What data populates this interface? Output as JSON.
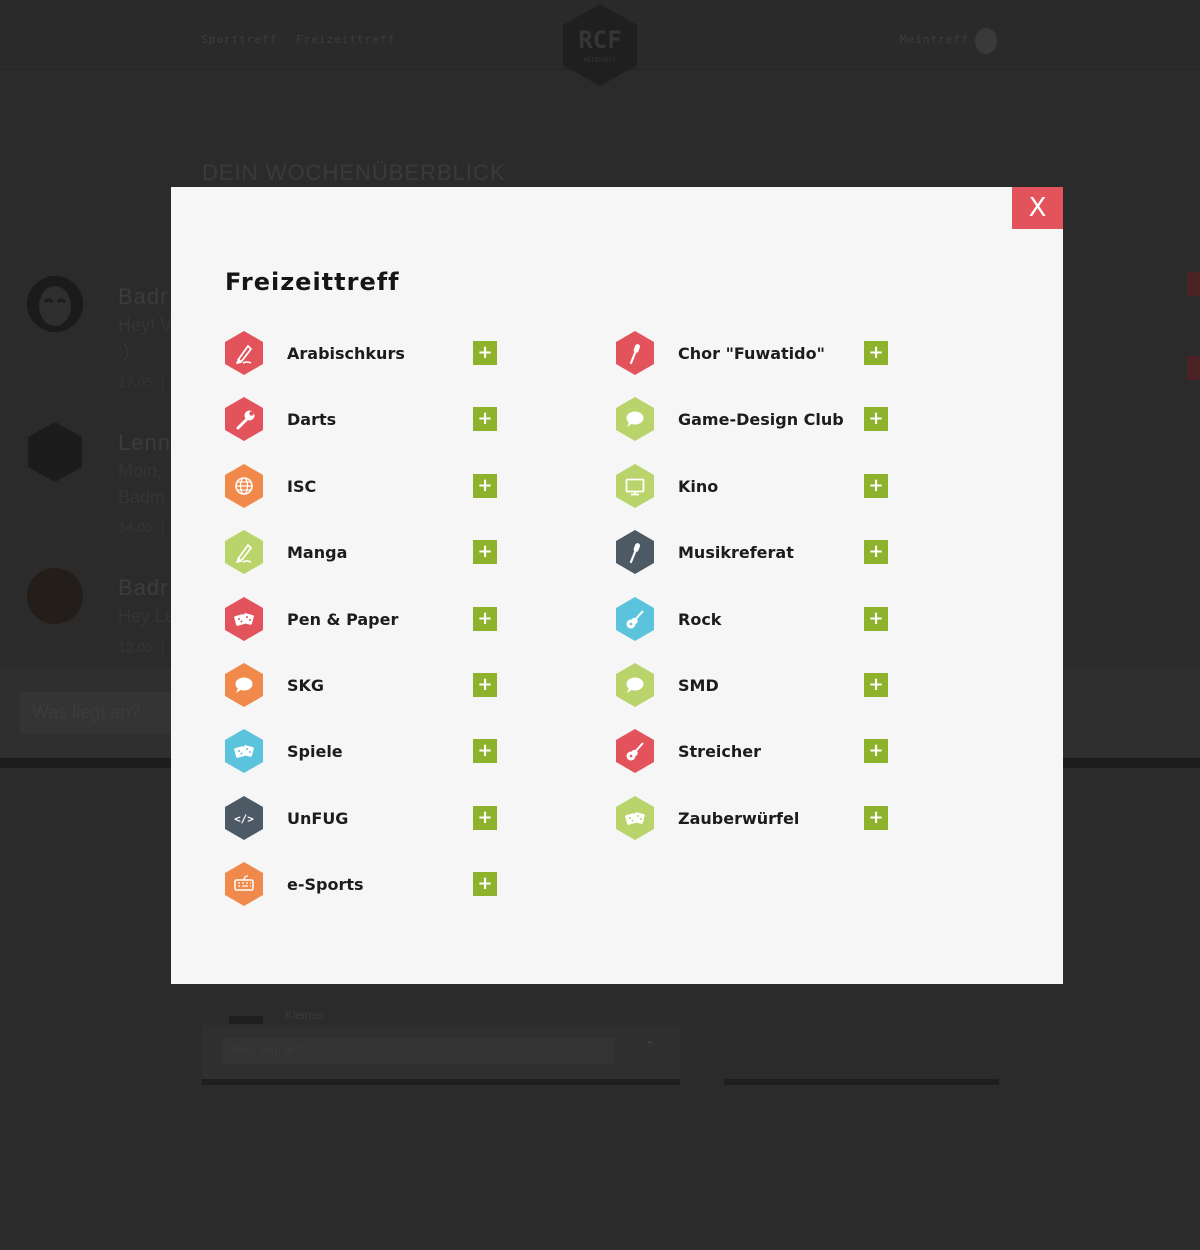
{
  "nav": {
    "left_links": [
      "Sporttreff",
      "Freizeittreff"
    ],
    "right_link": "Meintreff",
    "logo_text": "RCF",
    "logo_subtext": "MEINTREFF"
  },
  "background": {
    "week_title": "DEIN WOCHENÜBERBLICK",
    "feed": [
      {
        "name": "Badr",
        "text": "Hey! V",
        "text2": ":)",
        "date": "17.05. |"
      },
      {
        "name": "Lenn",
        "text": "Moin,",
        "text2": "Badm",
        "date": "14.05. |"
      },
      {
        "name": "Badr",
        "text": "Hey Le",
        "date": "12.05. |"
      }
    ],
    "input_placeholder": "Was liegt an?",
    "bottom_input_placeholder": "Was liegt an?",
    "bottom_item": "Kleines"
  },
  "modal": {
    "title": "Freizeittreff",
    "close_label": "X",
    "add_label": "+",
    "left_column": [
      {
        "name": "Arabischkurs",
        "icon": "pen-icon",
        "color": "#e2535c"
      },
      {
        "name": "Darts",
        "icon": "wrench-icon",
        "color": "#e2535c"
      },
      {
        "name": "ISC",
        "icon": "globe-icon",
        "color": "#f0894a"
      },
      {
        "name": "Manga",
        "icon": "pen-icon",
        "color": "#b8d46a"
      },
      {
        "name": "Pen & Paper",
        "icon": "dice-icon",
        "color": "#e2535c"
      },
      {
        "name": "SKG",
        "icon": "speech-bubble-icon",
        "color": "#f0894a"
      },
      {
        "name": "Spiele",
        "icon": "dice-icon",
        "color": "#5bc3dc"
      },
      {
        "name": "UnFUG",
        "icon": "code-icon",
        "color": "#4d5a66"
      },
      {
        "name": "e-Sports",
        "icon": "keyboard-icon",
        "color": "#f0894a"
      }
    ],
    "right_column": [
      {
        "name": "Chor \"Fuwatido\"",
        "icon": "microphone-icon",
        "color": "#e2535c"
      },
      {
        "name": "Game-Design Club",
        "icon": "speech-bubble-icon",
        "color": "#b8d46a"
      },
      {
        "name": "Kino",
        "icon": "monitor-icon",
        "color": "#b8d46a"
      },
      {
        "name": "Musikreferat",
        "icon": "microphone-icon",
        "color": "#4d5a66"
      },
      {
        "name": "Rock",
        "icon": "guitar-icon",
        "color": "#5bc3dc"
      },
      {
        "name": "SMD",
        "icon": "speech-bubble-icon",
        "color": "#b8d46a"
      },
      {
        "name": "Streicher",
        "icon": "guitar-icon",
        "color": "#e2535c"
      },
      {
        "name": "Zauberwürfel",
        "icon": "dice-icon",
        "color": "#b8d46a"
      }
    ],
    "add_button_color": "#8fb22c",
    "close_button_color": "#e2535c"
  }
}
